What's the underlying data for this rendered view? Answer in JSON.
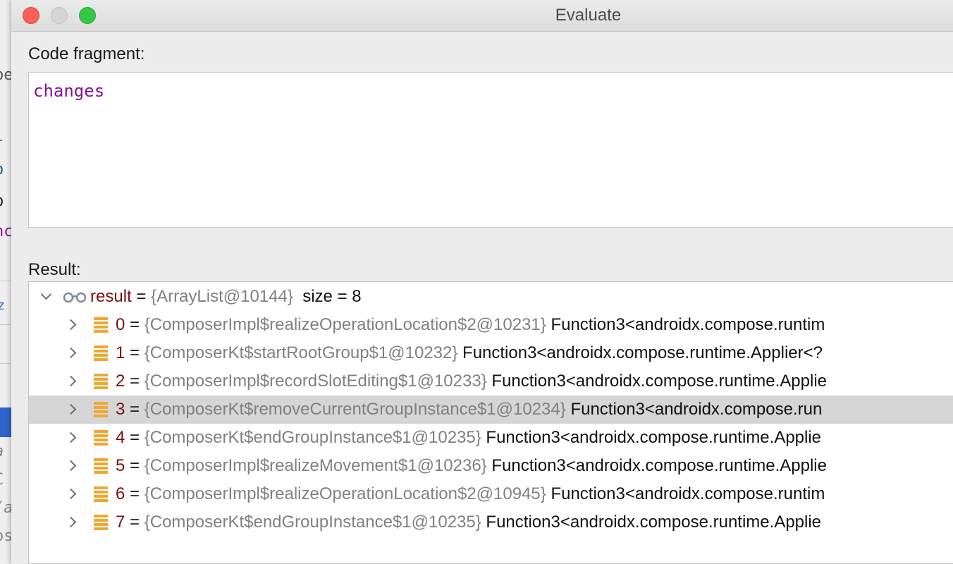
{
  "window": {
    "title": "Evaluate"
  },
  "code_fragment": {
    "label": "Code fragment:",
    "value": "changes"
  },
  "result_section": {
    "label": "Result:",
    "root": {
      "name": "result",
      "eq": "=",
      "value": "{ArrayList@10144}",
      "extra": "size = 8"
    },
    "items": [
      {
        "index": "0",
        "eq": "=",
        "value": "{ComposerImpl$realizeOperationLocation$2@10231}",
        "type": "Function3<androidx.compose.runtim"
      },
      {
        "index": "1",
        "eq": "=",
        "value": "{ComposerKt$startRootGroup$1@10232}",
        "type": "Function3<androidx.compose.runtime.Applier<?"
      },
      {
        "index": "2",
        "eq": "=",
        "value": "{ComposerImpl$recordSlotEditing$1@10233}",
        "type": "Function3<androidx.compose.runtime.Applie"
      },
      {
        "index": "3",
        "eq": "=",
        "value": "{ComposerKt$removeCurrentGroupInstance$1@10234}",
        "type": "Function3<androidx.compose.run"
      },
      {
        "index": "4",
        "eq": "=",
        "value": "{ComposerKt$endGroupInstance$1@10235}",
        "type": "Function3<androidx.compose.runtime.Applie"
      },
      {
        "index": "5",
        "eq": "=",
        "value": "{ComposerImpl$realizeMovement$1@10236}",
        "type": "Function3<androidx.compose.runtime.Applie"
      },
      {
        "index": "6",
        "eq": "=",
        "value": "{ComposerImpl$realizeOperationLocation$2@10945}",
        "type": "Function3<androidx.compose.runtim"
      },
      {
        "index": "7",
        "eq": "=",
        "value": "{ComposerKt$endGroupInstance$1@10235}",
        "type": "Function3<androidx.compose.runtime.Applie"
      }
    ],
    "selected_index": 3
  },
  "background_editor": {
    "fragments": [
      "pe",
      "l",
      "o",
      "p",
      "nc",
      "z",
      "a",
      "C",
      "(a",
      "os"
    ]
  },
  "colors": {
    "code_keyword": "#871094",
    "variable_name": "#7a0f10",
    "object_id": "#808080",
    "list_icon": "#f0a732",
    "selection": "#d5d5d5"
  }
}
